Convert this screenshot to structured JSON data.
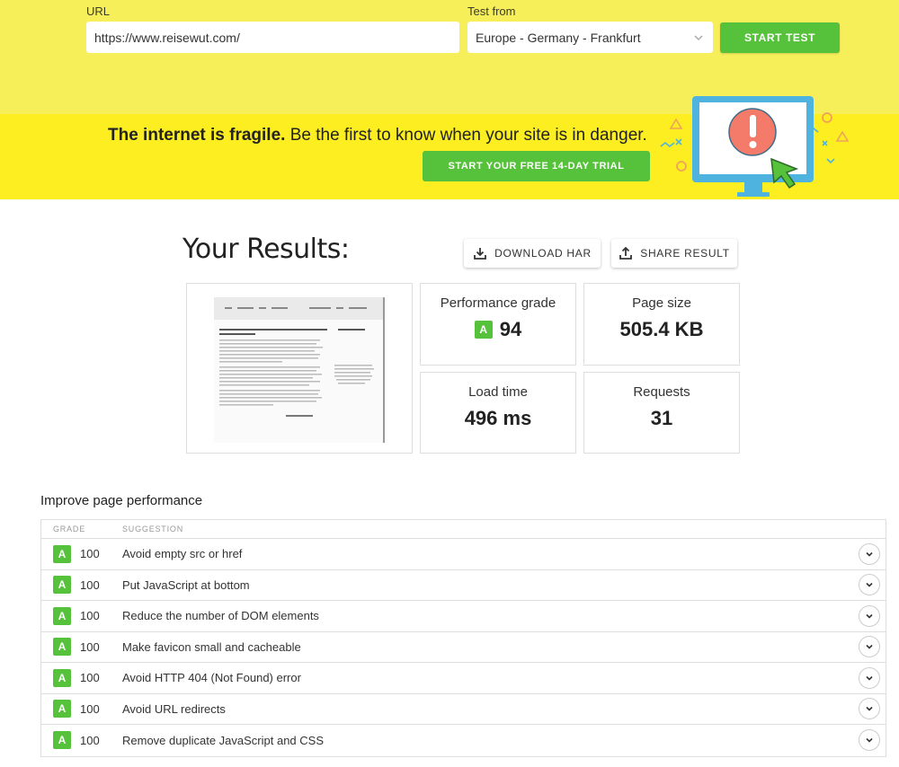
{
  "form": {
    "url_label": "URL",
    "url_value": "https://www.reisewut.com/",
    "location_label": "Test from",
    "location_value": "Europe - Germany - Frankfurt",
    "start_label": "START TEST"
  },
  "banner": {
    "bold_text": "The internet is fragile.",
    "rest_text": " Be the first to know when your site is in danger.",
    "trial_label": "START YOUR FREE 14-DAY TRIAL"
  },
  "results": {
    "title": "Your Results:",
    "download_label": "DOWNLOAD HAR",
    "share_label": "SHARE RESULT"
  },
  "metrics": {
    "performance": {
      "label": "Performance grade",
      "grade": "A",
      "value": "94"
    },
    "page_size": {
      "label": "Page size",
      "value": "505.4 KB"
    },
    "load_time": {
      "label": "Load time",
      "value": "496 ms"
    },
    "requests": {
      "label": "Requests",
      "value": "31"
    }
  },
  "improve": {
    "title": "Improve page performance",
    "col_grade": "GRADE",
    "col_suggestion": "SUGGESTION",
    "rows": [
      {
        "grade": "A",
        "score": "100",
        "suggestion": "Avoid empty src or href"
      },
      {
        "grade": "A",
        "score": "100",
        "suggestion": "Put JavaScript at bottom"
      },
      {
        "grade": "A",
        "score": "100",
        "suggestion": "Reduce the number of DOM elements"
      },
      {
        "grade": "A",
        "score": "100",
        "suggestion": "Make favicon small and cacheable"
      },
      {
        "grade": "A",
        "score": "100",
        "suggestion": "Avoid HTTP 404 (Not Found) error"
      },
      {
        "grade": "A",
        "score": "100",
        "suggestion": "Avoid URL redirects"
      },
      {
        "grade": "A",
        "score": "100",
        "suggestion": "Remove duplicate JavaScript and CSS"
      }
    ]
  },
  "colors": {
    "top_bg": "#f7ef5a",
    "banner_bg": "#fcee21",
    "green": "#56c13a"
  },
  "icons": [
    "chevron-down-icon",
    "download-icon",
    "share-icon",
    "monitor-alert-icon",
    "cursor-icon"
  ]
}
